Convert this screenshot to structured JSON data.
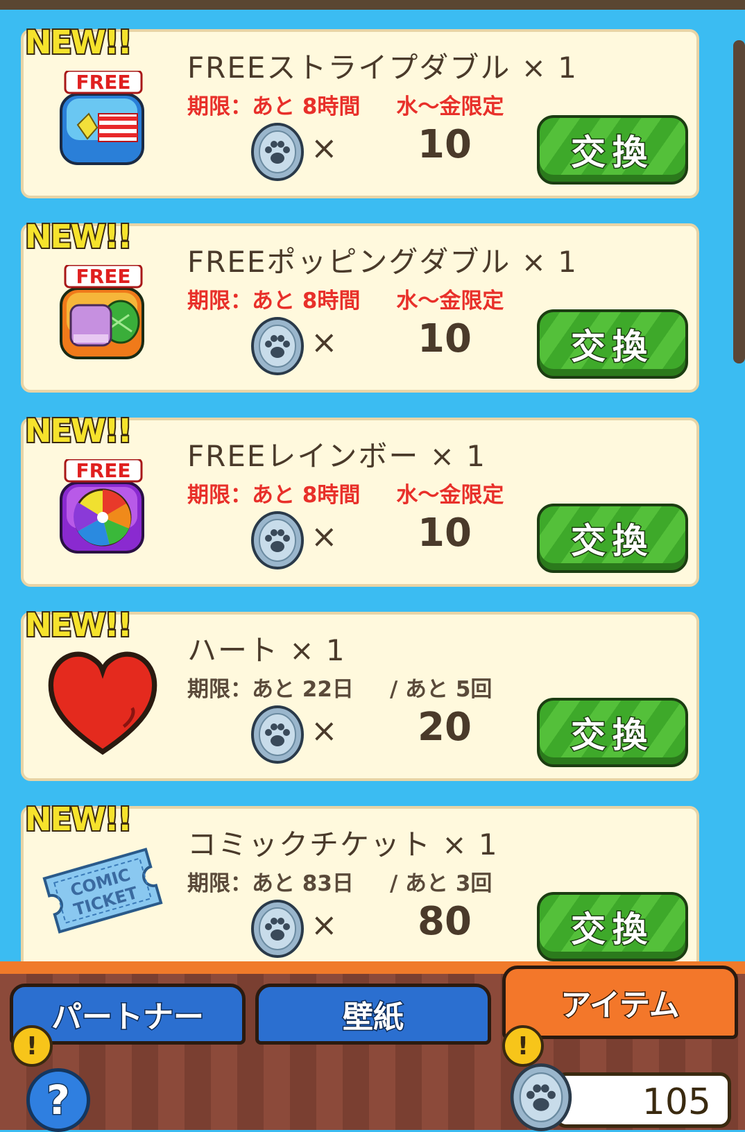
{
  "items": [
    {
      "badge": "NEW!!",
      "title": "FREEストライプダブル × 1",
      "limit": "期限：あと 8時間",
      "extra": "水〜金限定",
      "limit_style": "red",
      "times": "×",
      "price": "10",
      "button": "交換",
      "icon": "free-striped-icon"
    },
    {
      "badge": "NEW!!",
      "title": "FREEポッピングダブル × 1",
      "limit": "期限：あと 8時間",
      "extra": "水〜金限定",
      "limit_style": "red",
      "times": "×",
      "price": "10",
      "button": "交換",
      "icon": "free-popping-icon"
    },
    {
      "badge": "NEW!!",
      "title": "FREEレインボー × 1",
      "limit": "期限：あと 8時間",
      "extra": "水〜金限定",
      "limit_style": "red",
      "times": "×",
      "price": "10",
      "button": "交換",
      "icon": "free-rainbow-icon"
    },
    {
      "badge": "NEW!!",
      "title": "ハート × 1",
      "limit": "期限：あと 22日",
      "extra": "/ あと 5回",
      "limit_style": "dark",
      "times": "×",
      "price": "20",
      "button": "交換",
      "icon": "heart-icon"
    },
    {
      "badge": "NEW!!",
      "title": "コミックチケット × 1",
      "limit": "期限：あと 83日",
      "extra": "/ あと 3回",
      "limit_style": "dark",
      "times": "×",
      "price": "80",
      "button": "交換",
      "icon": "comic-ticket-icon"
    }
  ],
  "icon_labels": {
    "free": "FREE",
    "comic": "COMIC",
    "ticket": "TICKET"
  },
  "tabs": [
    {
      "label": "パートナー",
      "active": false
    },
    {
      "label": "壁紙",
      "active": false
    },
    {
      "label": "アイテム",
      "active": true
    }
  ],
  "alert_mark": "!",
  "help_mark": "?",
  "balance": "105",
  "colors": {
    "background": "#3bbcf2",
    "card": "#fff9dd",
    "button": "#3ea92a",
    "active_tab": "#f3772a",
    "inactive_tab": "#2b6fd0",
    "limit_red": "#e8302a"
  }
}
